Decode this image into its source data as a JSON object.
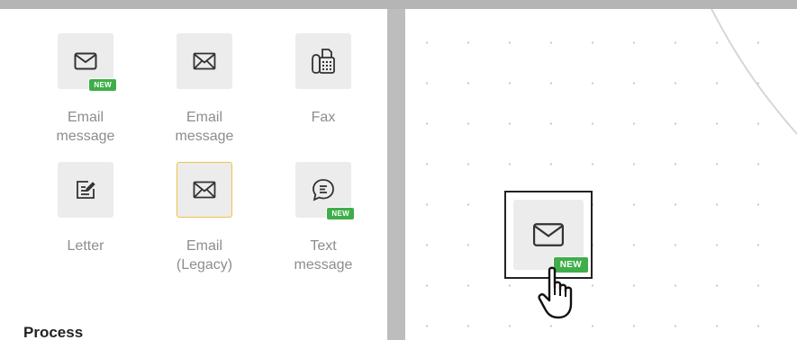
{
  "palette": {
    "items": [
      {
        "label_line1": "Email",
        "label_line2": "message",
        "icon": "envelope-icon",
        "badge": "NEW"
      },
      {
        "label_line1": "Email",
        "label_line2": "message",
        "icon": "envelope-outline-icon"
      },
      {
        "label_line1": "Fax",
        "label_line2": "",
        "icon": "fax-icon"
      },
      {
        "label_line1": "Letter",
        "label_line2": "",
        "icon": "letter-icon"
      },
      {
        "label_line1": "Email",
        "label_line2": "(Legacy)",
        "icon": "envelope-outline-icon"
      },
      {
        "label_line1": "Text",
        "label_line2": "message",
        "icon": "chat-bubble-icon",
        "badge": "NEW"
      }
    ],
    "section_heading": "Process"
  },
  "canvas": {
    "dragged_item": {
      "icon": "envelope-icon",
      "badge": "NEW"
    },
    "cursor": "hand-pointer-icon"
  },
  "colors": {
    "badge_green": "#3fae49",
    "selected_outline": "#f0c24a",
    "tile_bg": "#ececec",
    "label_gray": "#8d8d8d"
  }
}
